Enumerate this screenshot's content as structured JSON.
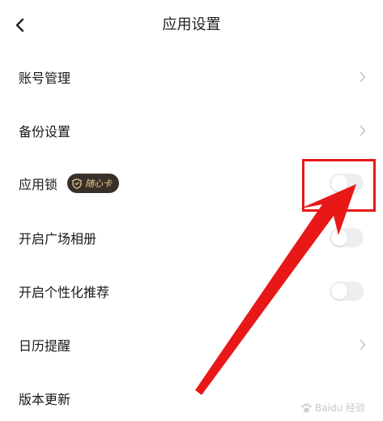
{
  "header": {
    "title": "应用设置",
    "back_icon": "chevron-left-icon"
  },
  "rows": [
    {
      "label": "账号管理",
      "control": "chevron"
    },
    {
      "label": "备份设置",
      "control": "chevron"
    },
    {
      "label": "应用锁",
      "control": "toggle",
      "toggle_on": false,
      "badge": "随心卡"
    },
    {
      "label": "开启广场相册",
      "control": "toggle",
      "toggle_on": false
    },
    {
      "label": "开启个性化推荐",
      "control": "toggle",
      "toggle_on": false
    },
    {
      "label": "日历提醒",
      "control": "chevron"
    },
    {
      "label": "版本更新",
      "control": "none"
    }
  ],
  "annotation": {
    "color": "#e81818"
  },
  "watermark": {
    "text": "Baidu 经验"
  },
  "colors": {
    "badge_bg": "#3a302a",
    "badge_text": "#e9c98e",
    "toggle_off": "#eeeeee"
  }
}
